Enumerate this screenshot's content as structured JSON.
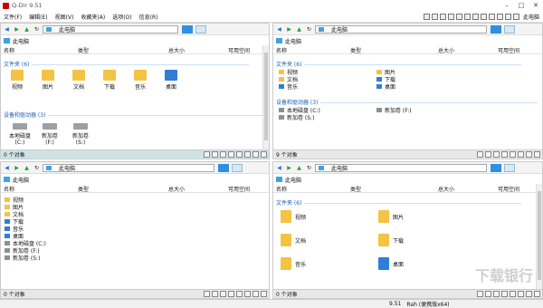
{
  "app": {
    "title": "Q-Dir 9.51"
  },
  "menu": [
    "文件(F)",
    "编辑(E)",
    "视图(V)",
    "收藏夹(A)",
    "选项(O)",
    "信息(R)"
  ],
  "toolbar": {
    "label": "此电脑"
  },
  "common": {
    "pc_name": "此电脑",
    "cols": {
      "name": "名称",
      "type": "类型",
      "total": "总大小",
      "free": "可用空间"
    },
    "group_folders": "文件夹 (6)",
    "group_drives": "设备和驱动器 (3)",
    "folders": [
      "视频",
      "图片",
      "文档",
      "下载",
      "音乐",
      "桌面"
    ],
    "drives": [
      "本地磁盘 (C:)",
      "新加卷 (F:)",
      "新加卷 (S:)"
    ]
  },
  "status": {
    "tl": "0 个对象",
    "tr": "9 个对象",
    "bl": "0 个对象",
    "br": "0 个对象"
  },
  "bottom": {
    "version": "9.51",
    "user": "Rah (便携版x64)"
  },
  "watermark": "下载银行"
}
